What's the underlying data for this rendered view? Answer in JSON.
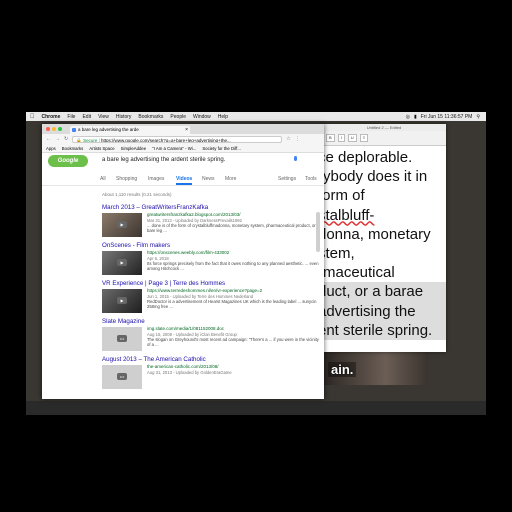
{
  "menubar": {
    "app": "Chrome",
    "items": [
      "File",
      "Edit",
      "View",
      "History",
      "Bookmarks",
      "People",
      "Window",
      "Help"
    ],
    "clock": "Fri Jun 15  11:36:57 PM"
  },
  "chrome": {
    "tab_title": "a bare leg advertising the arde",
    "url_secure": "Secure",
    "url": "https://www.google.com/search?q=a+bare+leg+advertising+the...",
    "bookmarks": [
      "Apps",
      "Bookmarks",
      "Artists Space",
      "SimpleAddee",
      "\"I Am a Camera\" - Wi...",
      "Society for the Diff..."
    ],
    "search_query": "a bare leg advertising the ardent sterile spring.",
    "nav_tabs": [
      "All",
      "Shopping",
      "Images",
      "Videos",
      "News",
      "More",
      "Settings",
      "Tools"
    ],
    "active_tab": "Videos",
    "results_count": "About 1,110 results (0.21 seconds)",
    "results": [
      {
        "title": "March 2013 – GreatWritersFranzKafka",
        "url": "greatwritersfranzkafka2.blogspot.com/2013/03/",
        "date": "Mar 31, 2013 - Uploaded by DarknessPrevails1992",
        "snippet": "... done is of the form of crystalbluffmadonna, monetary system, pharmaceutical product, or a bare leg ...",
        "duration": ""
      },
      {
        "title": "OnScenes - Film makers",
        "url": "https://onscenes.weebly.com/film-433002",
        "date": "Apr 6, 2018",
        "snippet": "Its force springs precisely from the fact that it owes nothing to any planned aesthetic. ... even among Hitchcock ...",
        "duration": ""
      },
      {
        "title": "VR Experience | Page 3 | Terre des Hommes",
        "url": "https://www.terredeshommes.nl/en/vr-experience?page=2",
        "date": "Jun 1, 2015 - Uploaded by Terre des Hommes Nederland",
        "snippet": "RedDoctor is a advertisement of Hearst Magazines UK which is the leading label ... sunycin 258mg free ...",
        "duration": ""
      },
      {
        "title": "Slate Magazine",
        "url": "img.slate.com/media/1/081152008.doc",
        "date": "Aug 15, 2008 - Uploaded by iClan Benefit Group",
        "snippet": "The slogan on Greyhound's most recent ad campaign: \"There's a ... if you were in the vicinity of a ...",
        "duration": ""
      },
      {
        "title": "August 2013 – The American Catholic",
        "url": "the-american-catholic.com/2013/08/",
        "date": "Aug 31, 2013 - Uploaded by GoldenEraGame",
        "snippet": "",
        "duration": ""
      }
    ]
  },
  "textedit": {
    "title": "Untitled 2 — Edited",
    "lines": [
      "ce deplorable.",
      "rybody does it in",
      "form of",
      "stalbluff-",
      "donna, monetary",
      "stem,",
      "rmaceutical",
      "duct, or a barae",
      "advertising the",
      "ent sterile spring."
    ]
  },
  "video": {
    "caption": "ain."
  },
  "colors": {
    "link": "#1a0dab",
    "url": "#006621",
    "accent": "#1a73e8"
  }
}
